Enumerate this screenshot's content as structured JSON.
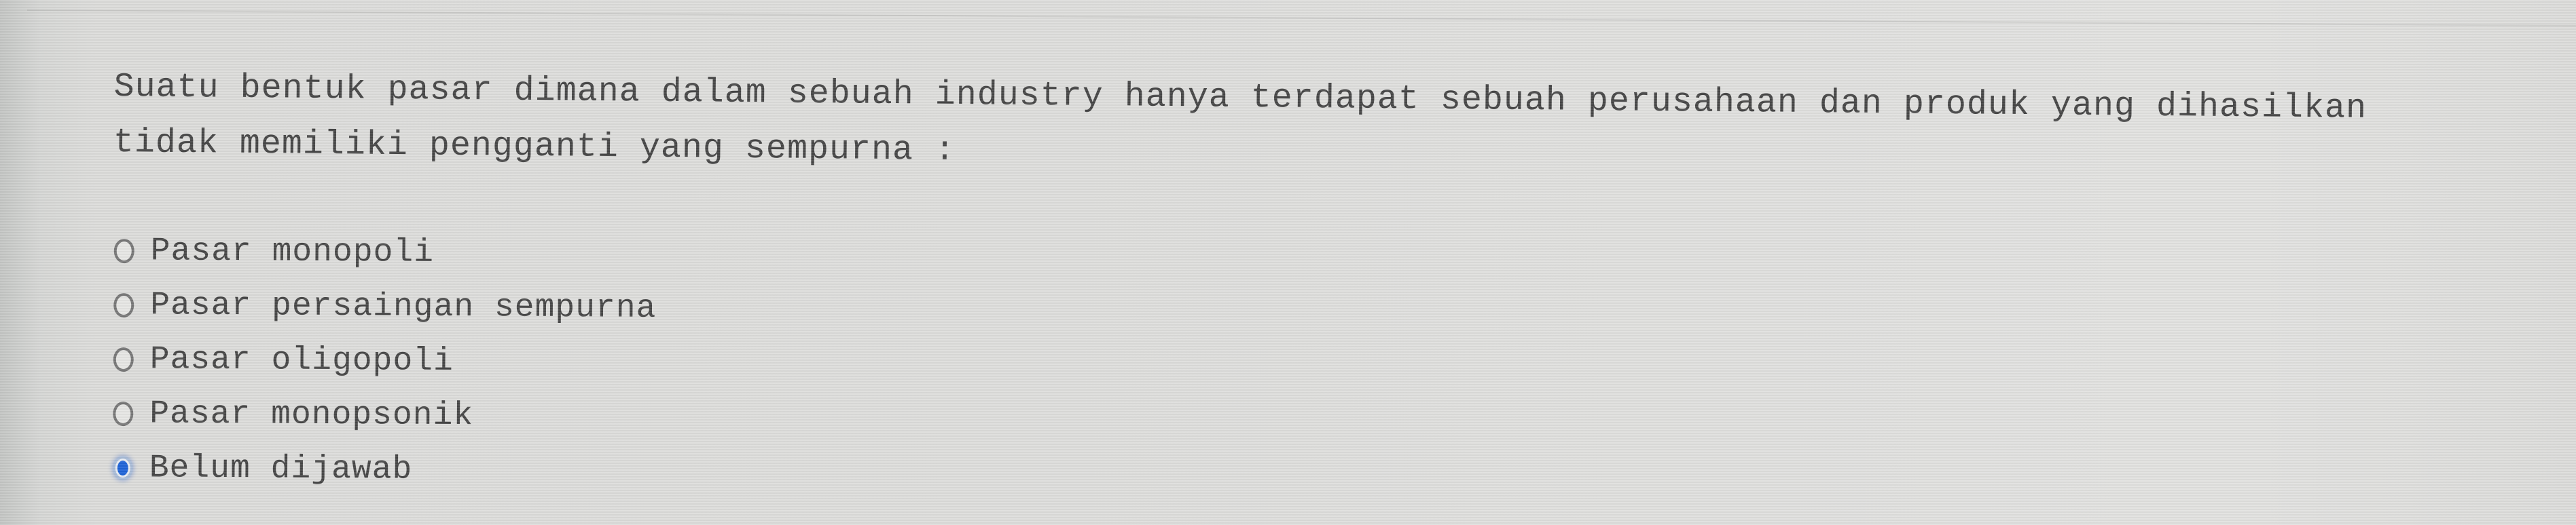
{
  "question": {
    "text": "Suatu bentuk pasar dimana dalam sebuah industry hanya terdapat sebuah perusahaan dan produk yang dihasilkan tidak memiliki pengganti yang sempurna :",
    "line1": "Suatu bentuk pasar dimana dalam sebuah industry hanya terdapat sebuah perusahaan dan produk yang dihasilkan",
    "line2": "tidak memiliki pengganti yang sempurna :"
  },
  "options": [
    {
      "label": "Pasar monopoli",
      "checked": false,
      "icon": "radio-unchecked-icon"
    },
    {
      "label": "Pasar persaingan sempurna",
      "checked": false,
      "icon": "radio-unchecked-icon"
    },
    {
      "label": "Pasar oligopoli",
      "checked": false,
      "icon": "radio-unchecked-icon"
    },
    {
      "label": "Pasar monopsonik",
      "checked": false,
      "icon": "radio-unchecked-icon"
    },
    {
      "label": "Belum dijawab",
      "checked": true,
      "icon": "radio-checked-icon"
    }
  ],
  "colors": {
    "accent": "#1e63d8",
    "text": "#464646",
    "background": "#dededc"
  }
}
